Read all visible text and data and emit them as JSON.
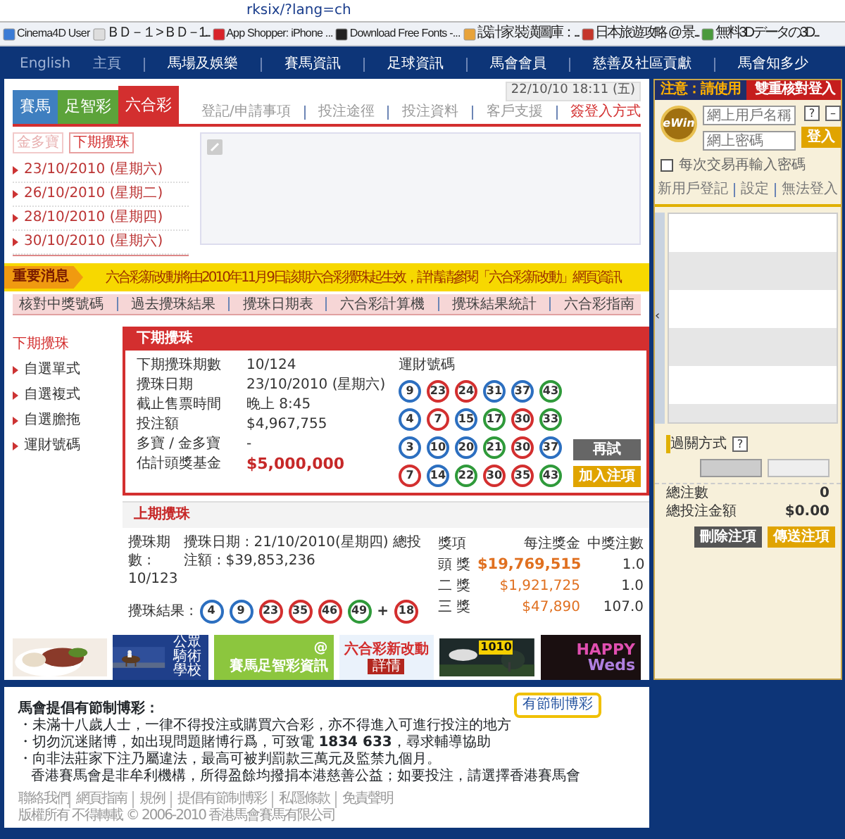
{
  "browser": {
    "address": "rksix/?lang=ch",
    "bookmarks": [
      {
        "label": "Cinema4D User",
        "color": "#3a7bd5"
      },
      {
        "label": "ＢＤ－１ > ＢＤ－1...",
        "color": "#dddddd"
      },
      {
        "label": "App Shopper: iPhone ...",
        "color": "#d8232a"
      },
      {
        "label": "Download Free Fonts -...",
        "color": "#222222"
      },
      {
        "label": "設計家 裝潢圖庫：...",
        "color": "#e8a33a"
      },
      {
        "label": "日本旅遊攻略 @ 景...",
        "color": "#c5362b"
      },
      {
        "label": "無料3Dデータの3D...",
        "color": "#4a9a3c"
      }
    ]
  },
  "nav": [
    {
      "label": "English",
      "kind": "dim"
    },
    {
      "label": "主頁",
      "kind": "dim"
    },
    {
      "label": "馬場及娛樂",
      "kind": "main"
    },
    {
      "label": "賽馬資訊",
      "kind": "main"
    },
    {
      "label": "足球資訊",
      "kind": "main"
    },
    {
      "label": "馬會會員",
      "kind": "main"
    },
    {
      "label": "慈善及社區貢獻",
      "kind": "main"
    },
    {
      "label": "馬會知多少",
      "kind": "main"
    }
  ],
  "tabs": [
    {
      "label": "賽馬",
      "color": "#3f7fc0",
      "selected": false
    },
    {
      "label": "足智彩",
      "color": "#5ca33a",
      "selected": false
    },
    {
      "label": "六合彩",
      "color": "#d32f2f",
      "selected": true
    }
  ],
  "datetime": "22/10/10 18:11 (五)",
  "sublinks": [
    {
      "label": "登記/申請事項",
      "kind": "plain"
    },
    {
      "label": "投注途徑",
      "kind": "plain"
    },
    {
      "label": "投注資料",
      "kind": "plain"
    },
    {
      "label": "客戶支援",
      "kind": "plain"
    },
    {
      "label": "簽登入方式",
      "kind": "alert"
    }
  ],
  "draw_dates": {
    "tabs": [
      {
        "label": "金多寶",
        "selected": false
      },
      {
        "label": "下期攪珠",
        "selected": true
      }
    ],
    "dates": [
      "23/10/2010 (星期六)",
      "26/10/2010 (星期二)",
      "28/10/2010 (星期四)",
      "30/10/2010 (星期六)"
    ]
  },
  "notice": {
    "label": "重要消息",
    "text": "六合彩新改動將由2010年11月9日該期六合彩攪珠起生效，詳情請參閱「六合彩新改動」網頁資訊"
  },
  "marksix_nav": [
    "核對中獎號碼",
    "過去攪珠結果",
    "攪珠日期表",
    "六合彩計算機",
    "攪珠結果統計",
    "六合彩指南"
  ],
  "side_menu": [
    {
      "label": "下期攪珠",
      "selected": true
    },
    {
      "label": "自選單式",
      "selected": false
    },
    {
      "label": "自選複式",
      "selected": false
    },
    {
      "label": "自選膽拖",
      "selected": false
    },
    {
      "label": "運財號碼",
      "selected": false
    }
  ],
  "next_draw": {
    "title": "下期攪珠",
    "rows": [
      {
        "label": "下期攪珠期數",
        "value": "10/124",
        "kind": "plain"
      },
      {
        "label": "攪珠日期",
        "value": "23/10/2010 (星期六)",
        "kind": "plain"
      },
      {
        "label": "截止售票時間",
        "value": "晚上 8:45",
        "kind": "plain"
      },
      {
        "label": "投注額",
        "value": "$4,967,755",
        "kind": "plain"
      },
      {
        "label": "多寶 / 金多寶",
        "value": "-",
        "kind": "plain"
      },
      {
        "label": "估計頭獎基金",
        "value": "$5,000,000",
        "kind": "highlight"
      }
    ],
    "lucky_title": "運財號碼",
    "lucky_rows": [
      {
        "balls": [
          {
            "number": "9",
            "color": "#2c6fc0"
          },
          {
            "number": "23",
            "color": "#d32f2f"
          },
          {
            "number": "24",
            "color": "#d32f2f"
          },
          {
            "number": "31",
            "color": "#2c6fc0"
          },
          {
            "number": "37",
            "color": "#2c6fc0"
          },
          {
            "number": "43",
            "color": "#2f9a3a"
          }
        ]
      },
      {
        "balls": [
          {
            "number": "4",
            "color": "#2c6fc0"
          },
          {
            "number": "7",
            "color": "#d32f2f"
          },
          {
            "number": "15",
            "color": "#2c6fc0"
          },
          {
            "number": "17",
            "color": "#2f9a3a"
          },
          {
            "number": "30",
            "color": "#d32f2f"
          },
          {
            "number": "33",
            "color": "#2f9a3a"
          }
        ]
      },
      {
        "balls": [
          {
            "number": "3",
            "color": "#2c6fc0"
          },
          {
            "number": "10",
            "color": "#2c6fc0"
          },
          {
            "number": "20",
            "color": "#2c6fc0"
          },
          {
            "number": "21",
            "color": "#2f9a3a"
          },
          {
            "number": "30",
            "color": "#d32f2f"
          },
          {
            "number": "37",
            "color": "#2c6fc0"
          }
        ]
      },
      {
        "balls": [
          {
            "number": "7",
            "color": "#d32f2f"
          },
          {
            "number": "14",
            "color": "#2c6fc0"
          },
          {
            "number": "22",
            "color": "#2f9a3a"
          },
          {
            "number": "30",
            "color": "#d32f2f"
          },
          {
            "number": "35",
            "color": "#d32f2f"
          },
          {
            "number": "43",
            "color": "#2f9a3a"
          }
        ]
      }
    ],
    "buttons": [
      {
        "label": "再試",
        "kind": "grey"
      },
      {
        "label": "加入注項",
        "kind": "gold"
      }
    ]
  },
  "last_draw": {
    "title": "上期攪珠",
    "period_label": "攪珠期數 :",
    "period": "10/123",
    "date_text": "攪珠日期 : 21/10/2010(星期四) 總投注額 : $39,853,236",
    "results_label": "攪珠結果 :",
    "balls": [
      {
        "number": "4",
        "color": "#2c6fc0"
      },
      {
        "number": "9",
        "color": "#2c6fc0"
      },
      {
        "number": "23",
        "color": "#d32f2f"
      },
      {
        "number": "35",
        "color": "#d32f2f"
      },
      {
        "number": "46",
        "color": "#d32f2f"
      },
      {
        "number": "49",
        "color": "#2f9a3a"
      }
    ],
    "plus": "+",
    "extra": {
      "number": "18",
      "color": "#d32f2f"
    },
    "prize_columns": [
      "獎項",
      "每注獎金",
      "中獎注數"
    ],
    "prizes": [
      {
        "name": "頭 獎",
        "amount": "$19,769,515",
        "count": "1.0",
        "kind": "top"
      },
      {
        "name": "二 獎",
        "amount": "$1,921,725",
        "count": "1.0",
        "kind": "plain"
      },
      {
        "name": "三 獎",
        "amount": "$47,890",
        "count": "107.0",
        "kind": "plain"
      }
    ]
  },
  "banners": [
    {
      "kind": "food"
    },
    {
      "kind": "riding",
      "text": "公眾騎術學校"
    },
    {
      "kind": "info",
      "symbol": "@",
      "text": "賽馬足智彩資訊"
    },
    {
      "kind": "change",
      "text": "六合彩新改動",
      "button": "詳情"
    },
    {
      "kind": "logo",
      "tag": "1010"
    },
    {
      "kind": "happy",
      "text": "HAPPY",
      "text2": "Weds"
    }
  ],
  "footer": {
    "title": "馬會提倡有節制博彩：",
    "lines": [
      "・未滿十八歲人士，一律不得投注或購買六合彩，亦不得進入可進行投注的地方",
      "・切勿沉迷賭博，如出現問題賭博行爲，可致電 **1834 633**，尋求輔導協助",
      "・向非法莊家下注乃屬違法，最高可被判罰款三萬元及監禁九個月。",
      "香港賽馬會是非牟利機構，所得盈餘均撥捐本港慈善公益；如要投注，請選擇香港賽馬會"
    ],
    "bubble": "有節制博彩",
    "links": [
      "聯絡我們",
      "網頁指南",
      "規例",
      "提倡有節制博彩",
      "私隱條款",
      "免責聲明"
    ],
    "copyright": "版權所有 不得轉載 © 2006-2010 香港馬會賽馬有限公司"
  },
  "login": {
    "warn": "注意：請使用",
    "warn2": "雙重核對登入",
    "logo": "eWin",
    "user_placeholder": "網上用戶名稱",
    "pass_placeholder": "網上密碼",
    "help": "?",
    "minimize": "–",
    "login_button": "登入",
    "remember": {
      "label": "每次交易再輸入密碼",
      "checked": false
    },
    "links": [
      "新用戶登記",
      "設定",
      "無法登入"
    ],
    "handle": "‹",
    "combo_label": "過關方式",
    "combo_help": "?",
    "totals": [
      {
        "label": "總注數",
        "value": "0"
      },
      {
        "label": "總投注金額",
        "value": "$0.00"
      }
    ],
    "buttons": [
      {
        "label": "刪除注項",
        "kind": "dark"
      },
      {
        "label": "傳送注項",
        "kind": "gold"
      }
    ]
  }
}
